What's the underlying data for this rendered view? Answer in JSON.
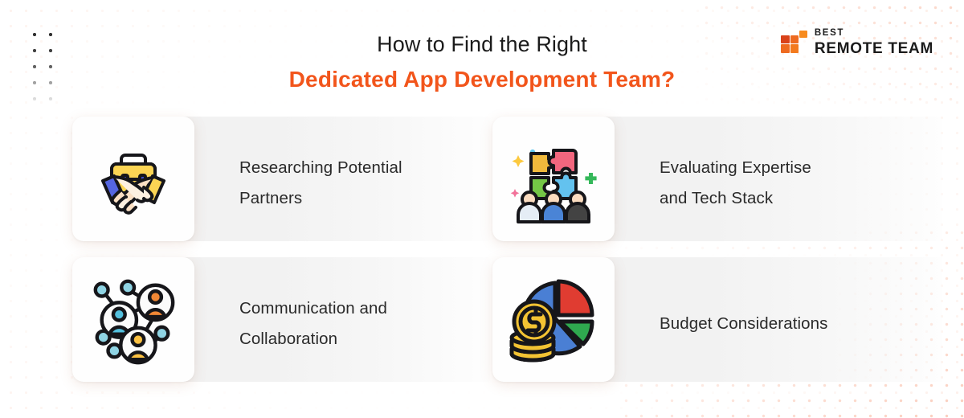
{
  "header": {
    "title_line1": "How to Find the Right",
    "title_line2": "Dedicated App Development Team?",
    "title_accent_color": "#f2551b"
  },
  "logo": {
    "mark_name": "best-remote-team-blocks-logo",
    "top_text": "BEST",
    "main_text": "REMOTE TEAM",
    "colors": {
      "block_dark": "#d9421a",
      "block_mid": "#ed6620",
      "block_light": "#f78b1f",
      "text": "#1b1b1b"
    }
  },
  "cards": [
    {
      "id": "researching-potential-partners",
      "icon": "handshake-briefcase-icon",
      "label": "Researching Potential\nPartners"
    },
    {
      "id": "evaluating-expertise-and-tech-stack",
      "icon": "puzzle-team-icon",
      "label": "Evaluating Expertise\nand Tech Stack"
    },
    {
      "id": "communication-and-collaboration",
      "icon": "network-people-icon",
      "label": "Communication and\nCollaboration"
    },
    {
      "id": "budget-considerations",
      "icon": "pie-chart-coins-icon",
      "label": "Budget Considerations"
    }
  ],
  "theme": {
    "background": "#ffffff",
    "panel": "#f1f1f1",
    "tile": "#fefefe",
    "text": "#2a2a2a",
    "dot_pattern": "#f05a22"
  }
}
